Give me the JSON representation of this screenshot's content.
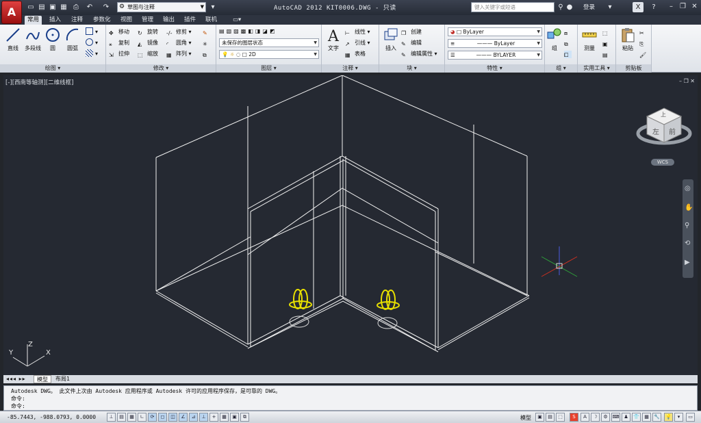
{
  "titlebar": {
    "app_logo": "A",
    "workspace": "草图与注释",
    "title": "AutoCAD 2012    KIT0006.DWG - 只读",
    "search_placeholder": "键入关键字或短语",
    "login": "登录",
    "quick_access_icons": [
      "new-icon",
      "open-icon",
      "save-icon",
      "saveas-icon",
      "print-icon",
      "undo-icon",
      "redo-icon"
    ]
  },
  "ribbon_tabs": [
    "常用",
    "插入",
    "注释",
    "参数化",
    "视图",
    "管理",
    "输出",
    "插件",
    "联机"
  ],
  "active_tab": "常用",
  "panels": {
    "draw": {
      "title": "绘图",
      "line": "直线",
      "polyline": "多段线",
      "circle": "圆",
      "arc": "圆弧"
    },
    "modify": {
      "title": "修改",
      "move": "移动",
      "rotate": "旋转",
      "trim": "修剪",
      "copy": "复制",
      "mirror": "镜像",
      "fillet": "圆角",
      "stretch": "拉伸",
      "scale": "缩放",
      "array": "阵列"
    },
    "layers": {
      "title": "图层",
      "layer_state": "未保存的图层状态",
      "current_layer": "2D"
    },
    "annotation": {
      "title": "注释",
      "text": "文字",
      "linear": "线性",
      "leader": "引线",
      "table": "表格"
    },
    "block": {
      "title": "块",
      "insert": "插入",
      "create": "创建",
      "edit": "编辑",
      "edit_attributes": "编辑属性"
    },
    "properties": {
      "title": "特性",
      "color": "ByLayer",
      "linetype": "ByLayer",
      "lineweight": "BYLAYER"
    },
    "groups": {
      "title": "组",
      "group": "组"
    },
    "utilities": {
      "title": "实用工具",
      "measure": "测量"
    },
    "clipboard": {
      "title": "剪贴板",
      "paste": "粘贴"
    }
  },
  "viewport": {
    "label": "[-][西南等轴测][二维线框]",
    "viewcube_top": "上",
    "viewcube_front": "前",
    "viewcube_left": "左",
    "wcs": "WCS",
    "ucs_x": "X",
    "ucs_y": "Y",
    "ucs_z": "Z",
    "colors": {
      "background": "#252932",
      "wire": "#ffffff",
      "fixture": "#e8e000",
      "accent_red": "#d03020",
      "accent_green": "#2fa03a"
    }
  },
  "layout_tabs": [
    "模型",
    "布局1"
  ],
  "active_layout": "模型",
  "command_line": {
    "history": "Autodesk DWG。  此文件上次由 Autodesk 应用程序或 Autodesk 许可的应用程序保存，是可靠的 DWG。",
    "prompt1": "命令:",
    "prompt2": "命令:"
  },
  "statusbar": {
    "coords": "-85.7443,  -988.0793, 0.0000",
    "model": "模型"
  }
}
